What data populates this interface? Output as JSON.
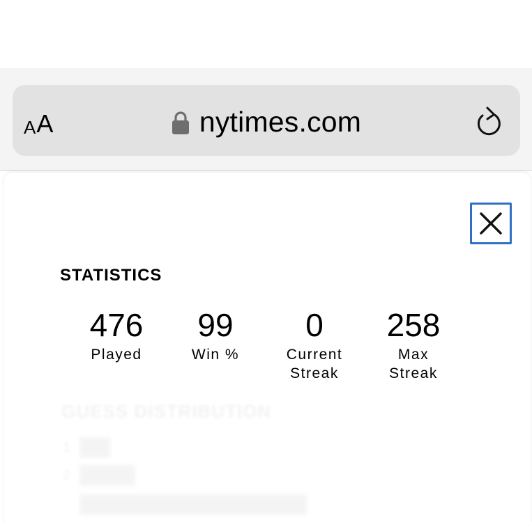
{
  "browser": {
    "text_size_small": "A",
    "text_size_large": "A",
    "url": "nytimes.com"
  },
  "statistics": {
    "title": "STATISTICS",
    "items": [
      {
        "value": "476",
        "label": "Played"
      },
      {
        "value": "99",
        "label": "Win %"
      },
      {
        "value": "0",
        "label": "Current\nStreak"
      },
      {
        "value": "258",
        "label": "Max\nStreak"
      }
    ]
  },
  "faded_section": {
    "heading": "GUESS DISTRIBUTION",
    "row_numbers": [
      "1",
      "2"
    ]
  },
  "colors": {
    "close_border": "#2f6fc4",
    "chrome_bg": "#f4f4f4",
    "url_bar_bg": "#e2e2e2"
  }
}
